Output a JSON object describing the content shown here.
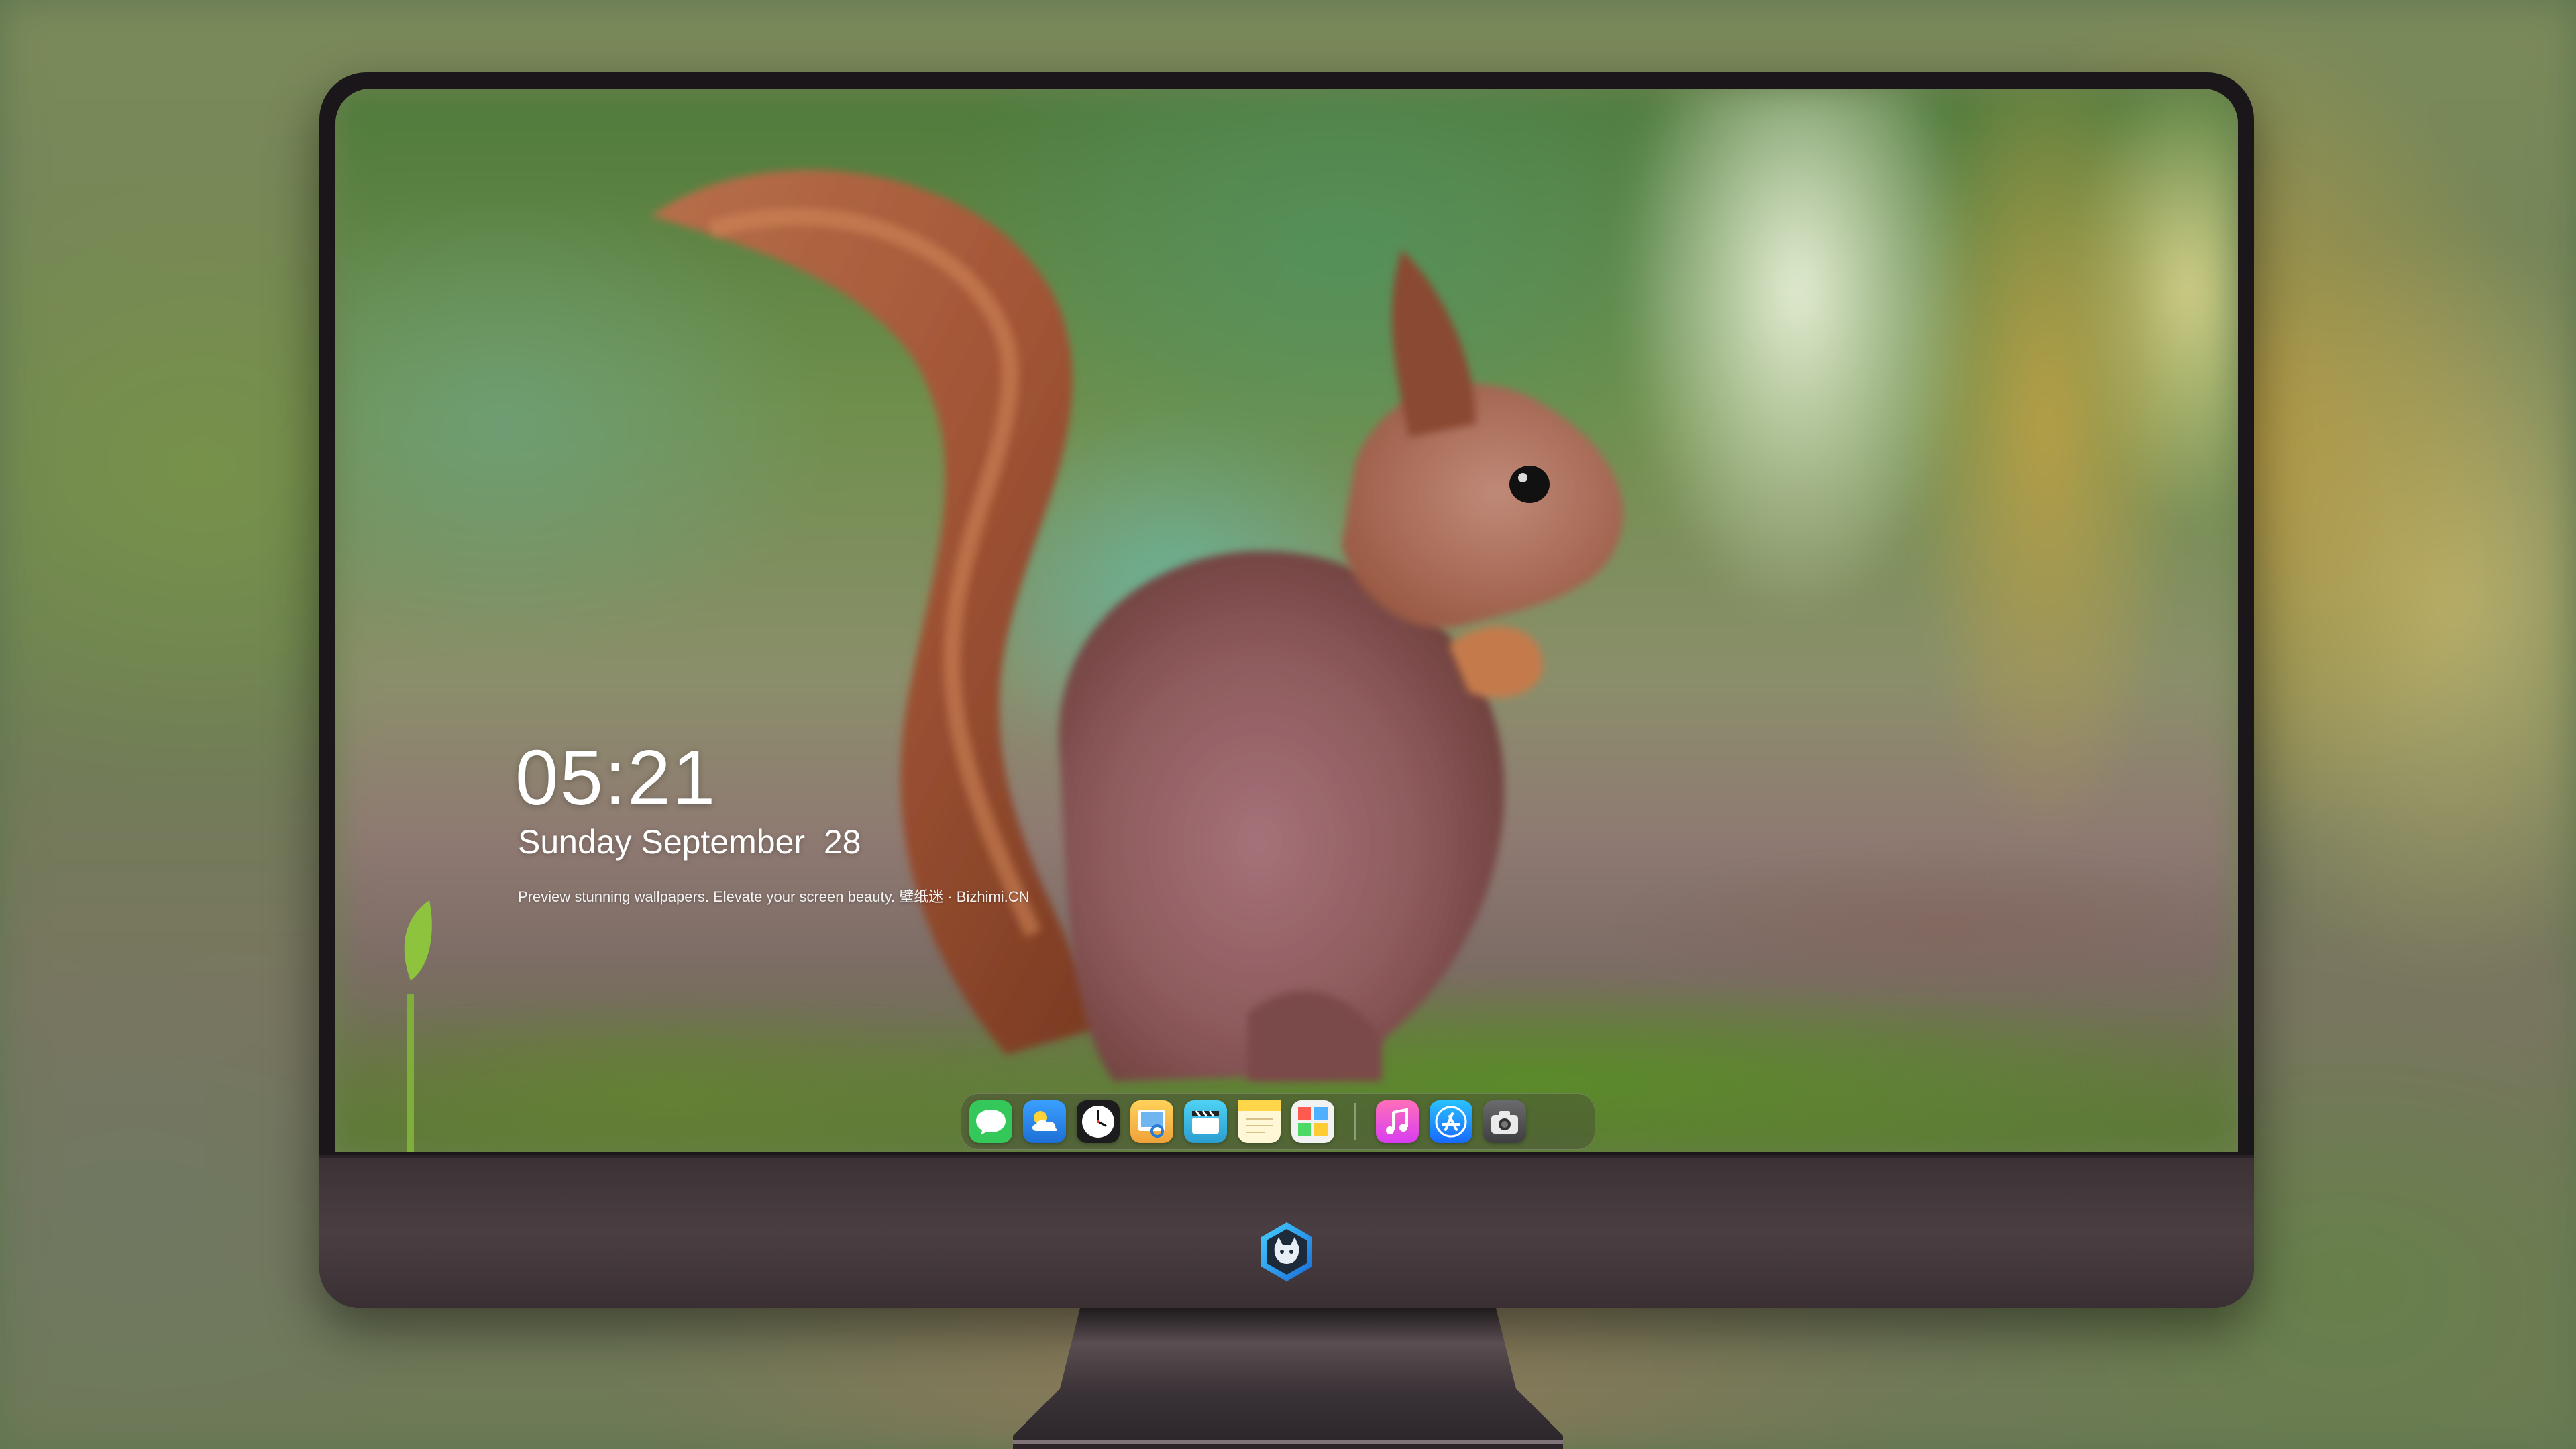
{
  "lockscreen": {
    "time": "05:21",
    "date": "Sunday September  28",
    "tagline": "Preview stunning wallpapers. Elevate your screen beauty. 壁纸迷 · Bizhimi.CN"
  },
  "dock": {
    "apps": [
      {
        "name": "messages-icon",
        "color": "#34c759"
      },
      {
        "name": "weather-icon",
        "color": "#2a8cf0"
      },
      {
        "name": "clock-icon",
        "color": "#1c1c1e"
      },
      {
        "name": "preview-icon",
        "color": "#f2b632"
      },
      {
        "name": "video-clapper-icon",
        "color": "#3ab7e8"
      },
      {
        "name": "notes-icon",
        "color": "#ffd54a"
      },
      {
        "name": "photo-booth-icon",
        "color": "#e9e9e9"
      },
      {
        "name": "music-icon",
        "color": "#fb4fa3"
      },
      {
        "name": "app-store-icon",
        "color": "#1e90ff"
      },
      {
        "name": "camera-icon",
        "color": "#5a5a5e"
      }
    ]
  },
  "colors": {
    "bezel": "#1a1619",
    "chin": "#4a3e42",
    "text": "#ffffff"
  }
}
